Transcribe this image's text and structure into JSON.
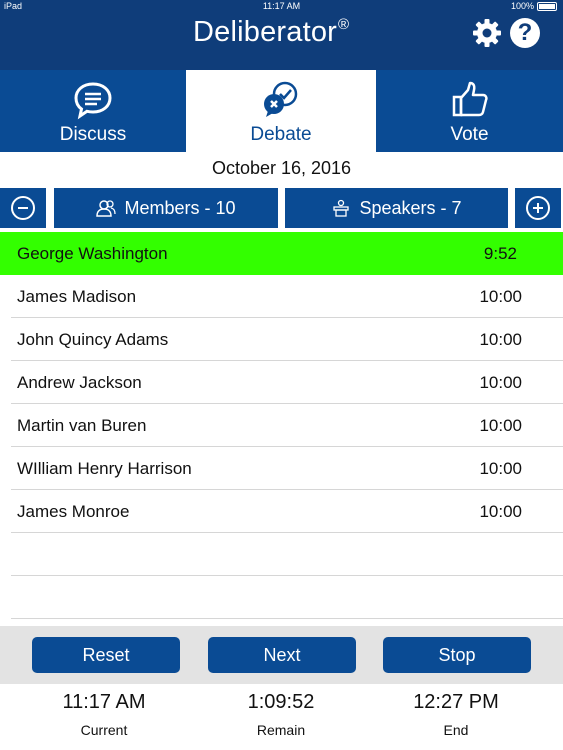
{
  "status_bar": {
    "device": "iPad",
    "time": "11:17 AM",
    "battery": "100%"
  },
  "app": {
    "title": "Deliberator",
    "trademark": "®",
    "settings_icon": "gear-icon",
    "help_icon": "question-icon",
    "help_glyph": "?"
  },
  "tabs": [
    {
      "label": "Discuss",
      "icon": "chat-bubble-icon",
      "active": false
    },
    {
      "label": "Debate",
      "icon": "debate-bubbles-icon",
      "active": true
    },
    {
      "label": "Vote",
      "icon": "thumbs-up-icon",
      "active": false
    }
  ],
  "date": "October 16, 2016",
  "toolbar": {
    "members_label": "Members - 10",
    "speakers_label": "Speakers - 7",
    "remove_icon": "minus-circle-icon",
    "add_icon": "plus-circle-icon"
  },
  "speakers": [
    {
      "name": "George Washington",
      "time": "9:52",
      "current": true
    },
    {
      "name": "James Madison",
      "time": "10:00"
    },
    {
      "name": "John Quincy Adams",
      "time": "10:00"
    },
    {
      "name": "Andrew Jackson",
      "time": "10:00"
    },
    {
      "name": "Martin van Buren",
      "time": "10:00"
    },
    {
      "name": "WIlliam Henry Harrison",
      "time": "10:00"
    },
    {
      "name": "James Monroe",
      "time": "10:00"
    }
  ],
  "controls": {
    "reset": "Reset",
    "next": "Next",
    "stop": "Stop"
  },
  "clock": {
    "current_value": "11:17 AM",
    "current_label": "Current",
    "remain_value": "1:09:52",
    "remain_label": "Remain",
    "end_value": "12:27 PM",
    "end_label": "End"
  },
  "colors": {
    "header": "#0f3d7a",
    "tab": "#0a4b94",
    "highlight": "#33ff00",
    "controls_bg": "#e3e3e3"
  }
}
